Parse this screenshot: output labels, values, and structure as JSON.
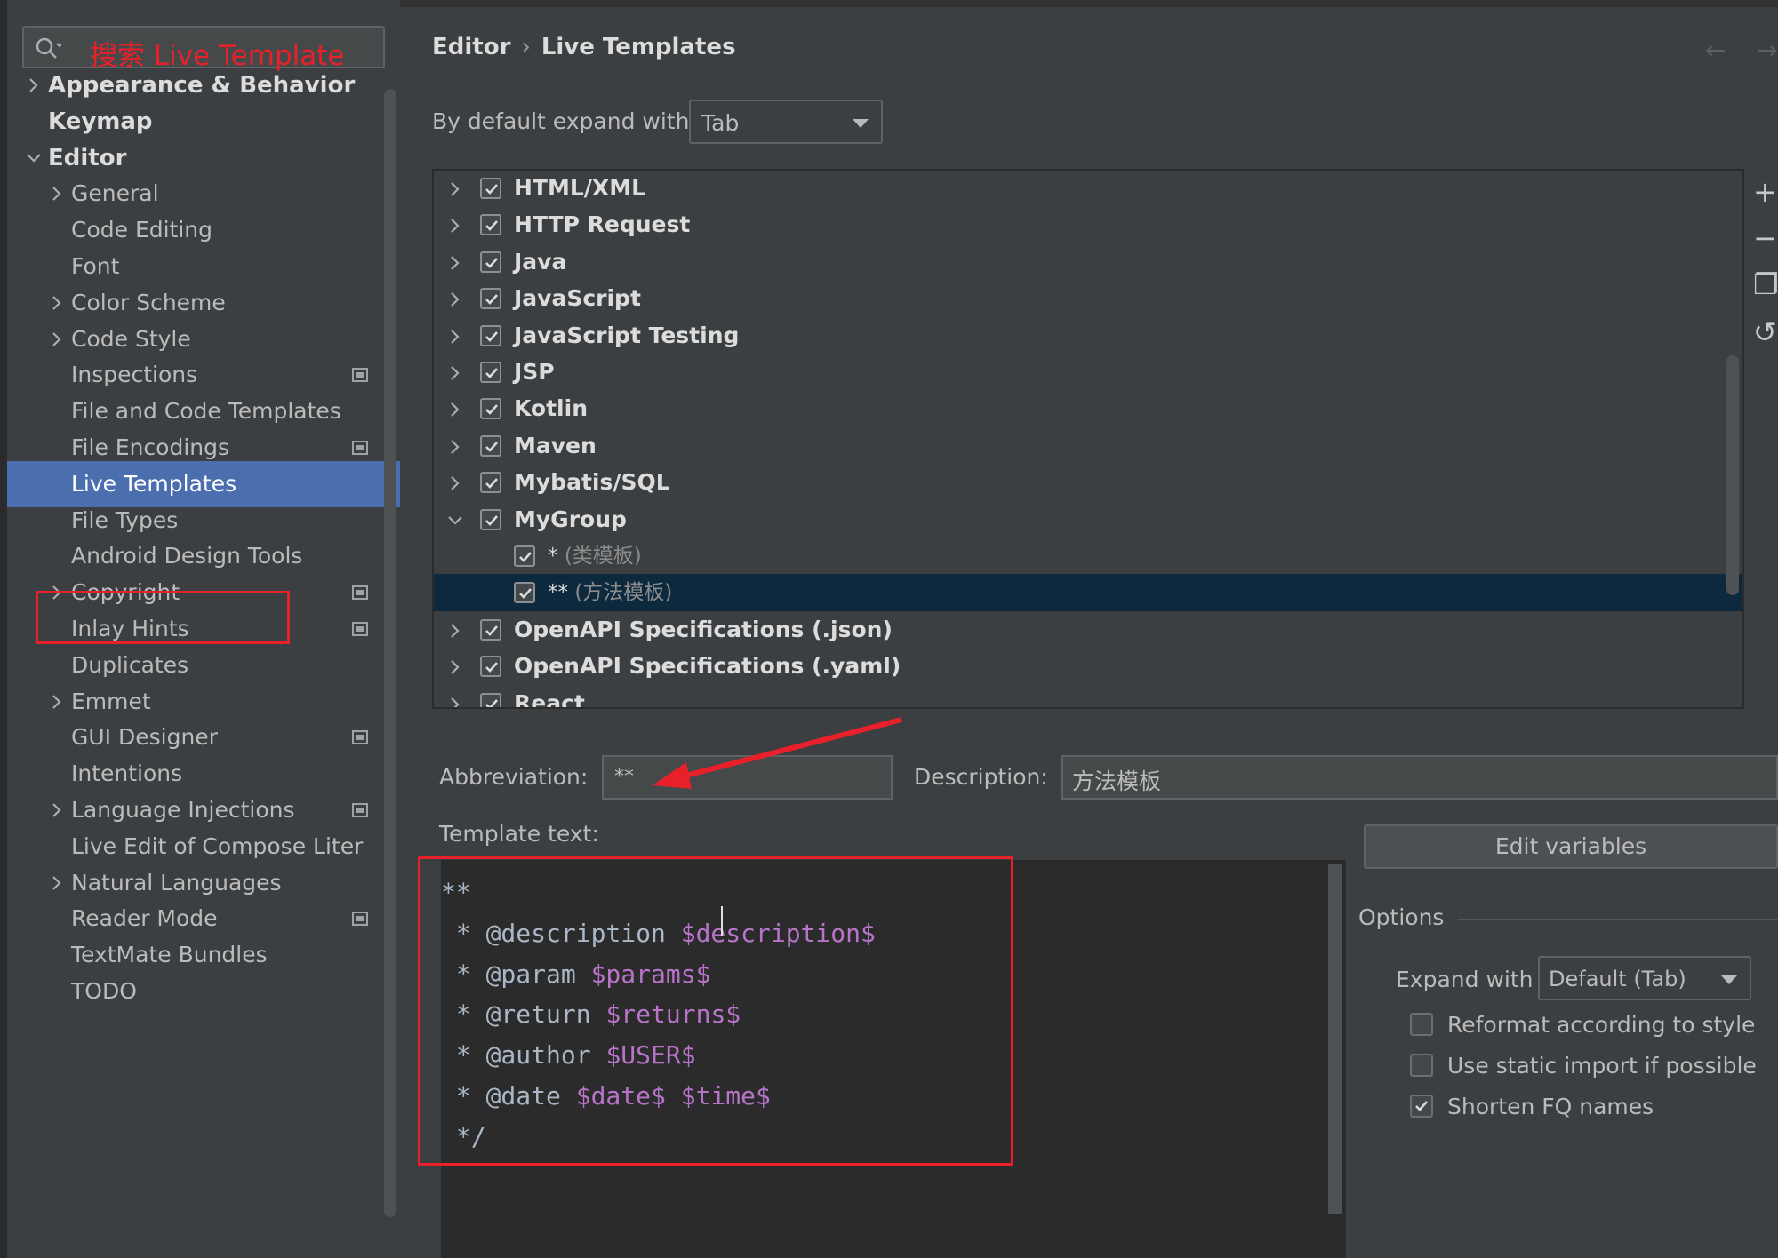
{
  "search": {
    "placeholder": "搜索 Live Template"
  },
  "sidebar": {
    "items": [
      {
        "label": "Appearance & Behavior",
        "arrow": "right",
        "level": 0
      },
      {
        "label": "Keymap",
        "arrow": "",
        "level": 0
      },
      {
        "label": "Editor",
        "arrow": "down",
        "level": 0
      },
      {
        "label": "General",
        "arrow": "right",
        "level": 1
      },
      {
        "label": "Code Editing",
        "arrow": "",
        "level": 1
      },
      {
        "label": "Font",
        "arrow": "",
        "level": 1
      },
      {
        "label": "Color Scheme",
        "arrow": "right",
        "level": 1
      },
      {
        "label": "Code Style",
        "arrow": "right",
        "level": 1
      },
      {
        "label": "Inspections",
        "arrow": "",
        "level": 1,
        "project": true
      },
      {
        "label": "File and Code Templates",
        "arrow": "",
        "level": 1
      },
      {
        "label": "File Encodings",
        "arrow": "",
        "level": 1,
        "project": true
      },
      {
        "label": "Live Templates",
        "arrow": "",
        "level": 1,
        "selected": true
      },
      {
        "label": "File Types",
        "arrow": "",
        "level": 1
      },
      {
        "label": "Android Design Tools",
        "arrow": "",
        "level": 1
      },
      {
        "label": "Copyright",
        "arrow": "right",
        "level": 1,
        "project": true
      },
      {
        "label": "Inlay Hints",
        "arrow": "",
        "level": 1,
        "project": true
      },
      {
        "label": "Duplicates",
        "arrow": "",
        "level": 1
      },
      {
        "label": "Emmet",
        "arrow": "right",
        "level": 1
      },
      {
        "label": "GUI Designer",
        "arrow": "",
        "level": 1,
        "project": true
      },
      {
        "label": "Intentions",
        "arrow": "",
        "level": 1
      },
      {
        "label": "Language Injections",
        "arrow": "right",
        "level": 1,
        "project": true
      },
      {
        "label": "Live Edit of Compose Liter",
        "arrow": "",
        "level": 1
      },
      {
        "label": "Natural Languages",
        "arrow": "right",
        "level": 1
      },
      {
        "label": "Reader Mode",
        "arrow": "",
        "level": 1,
        "project": true
      },
      {
        "label": "TextMate Bundles",
        "arrow": "",
        "level": 1
      },
      {
        "label": "TODO",
        "arrow": "",
        "level": 1
      }
    ]
  },
  "breadcrumb": {
    "parent": "Editor",
    "current": "Live Templates"
  },
  "nav": {
    "back": "←",
    "forward": "→"
  },
  "expand": {
    "label": "By default expand with",
    "value": "Tab"
  },
  "groups": [
    {
      "label": "HTML/XML",
      "type": "group",
      "arrow": "right",
      "checked": true
    },
    {
      "label": "HTTP Request",
      "type": "group",
      "arrow": "right",
      "checked": true
    },
    {
      "label": "Java",
      "type": "group",
      "arrow": "right",
      "checked": true
    },
    {
      "label": "JavaScript",
      "type": "group",
      "arrow": "right",
      "checked": true
    },
    {
      "label": "JavaScript Testing",
      "type": "group",
      "arrow": "right",
      "checked": true
    },
    {
      "label": "JSP",
      "type": "group",
      "arrow": "right",
      "checked": true
    },
    {
      "label": "Kotlin",
      "type": "group",
      "arrow": "right",
      "checked": true
    },
    {
      "label": "Maven",
      "type": "group",
      "arrow": "right",
      "checked": true
    },
    {
      "label": "Mybatis/SQL",
      "type": "group",
      "arrow": "right",
      "checked": true
    },
    {
      "label": "MyGroup",
      "type": "group",
      "arrow": "down",
      "checked": true
    },
    {
      "label": "*",
      "desc": "(类模板)",
      "type": "template",
      "checked": true
    },
    {
      "label": "**",
      "desc": "(方法模板)",
      "type": "template",
      "checked": true,
      "selected": true
    },
    {
      "label": "OpenAPI Specifications (.json)",
      "type": "group",
      "arrow": "right",
      "checked": true
    },
    {
      "label": "OpenAPI Specifications (.yaml)",
      "type": "group",
      "arrow": "right",
      "checked": true
    },
    {
      "label": "React",
      "type": "group",
      "arrow": "right",
      "checked": true
    }
  ],
  "tools": {
    "add": "+",
    "remove": "−",
    "copy": "❐",
    "restore": "↺"
  },
  "abbreviation": {
    "label": "Abbreviation:",
    "value": "**"
  },
  "description": {
    "label": "Description:",
    "value": "方法模板"
  },
  "template_text": {
    "label": "Template text:",
    "lines": [
      [
        {
          "t": "**"
        }
      ],
      [
        {
          "t": " * @description "
        },
        {
          "t": "$description$",
          "v": true
        }
      ],
      [
        {
          "t": " * @param "
        },
        {
          "t": "$params$",
          "v": true
        }
      ],
      [
        {
          "t": " * @return "
        },
        {
          "t": "$returns$",
          "v": true
        }
      ],
      [
        {
          "t": " * @author "
        },
        {
          "t": "$USER$",
          "v": true
        }
      ],
      [
        {
          "t": " * @date "
        },
        {
          "t": "$date$",
          "v": true
        },
        {
          "t": " "
        },
        {
          "t": "$time$",
          "v": true
        }
      ],
      [
        {
          "t": " */"
        }
      ]
    ]
  },
  "edit_variables": {
    "label": "Edit variables"
  },
  "options": {
    "title": "Options",
    "expand_with_label": "Expand with",
    "expand_with_value": "Default (Tab)",
    "checkboxes": [
      {
        "label": "Reformat according to style",
        "checked": false
      },
      {
        "label": "Use static import if possible",
        "checked": false
      },
      {
        "label": "Shorten FQ names",
        "checked": true
      }
    ]
  },
  "colors": {
    "accent_selection": "#4b6eaf",
    "annotation_red": "#e8202a",
    "template_variable": "#b774c9",
    "selected_row": "#0d293e"
  }
}
